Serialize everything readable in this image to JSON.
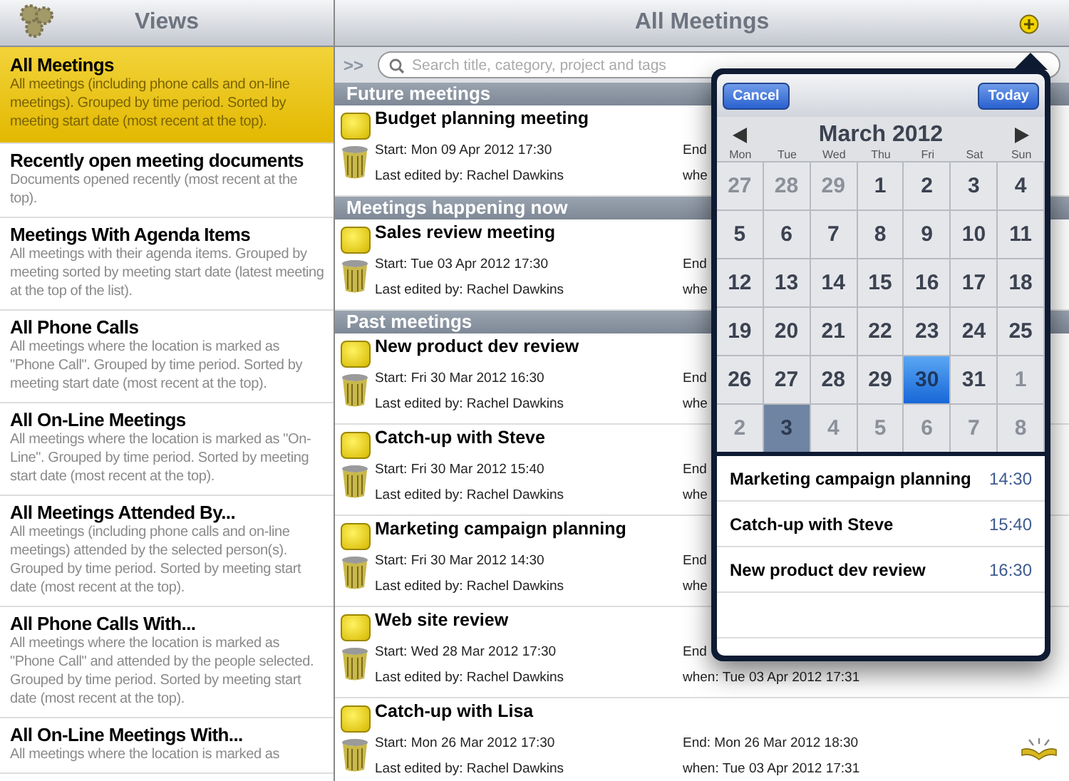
{
  "sidebar": {
    "title": "Views",
    "items": [
      {
        "title": "All Meetings",
        "description": "All meetings (including phone calls and on-line meetings). Grouped by time period. Sorted by meeting start date (most recent at the top).",
        "selected": true
      },
      {
        "title": "Recently open meeting documents",
        "description": "Documents opened recently (most recent at the top).",
        "selected": false
      },
      {
        "title": "Meetings With Agenda Items",
        "description": "All meetings with their agenda items. Grouped by meeting sorted by meeting start date (latest meeting at the top of the list).",
        "selected": false
      },
      {
        "title": "All Phone Calls",
        "description": "All meetings where the location is marked as \"Phone Call\". Grouped by time period. Sorted by meeting start date (most recent at the top).",
        "selected": false
      },
      {
        "title": "All On-Line Meetings",
        "description": "All meetings where the location is marked as \"On-Line\". Grouped by time period. Sorted by meeting start date (most recent at the top).",
        "selected": false
      },
      {
        "title": "All Meetings Attended By...",
        "description": "All meetings (including phone calls and on-line meetings) attended by the selected person(s). Grouped by time period. Sorted by meeting start date (most recent at the top).",
        "selected": false
      },
      {
        "title": "All Phone Calls With...",
        "description": "All meetings where the location is marked as \"Phone Call\" and attended by the people selected. Grouped by time period. Sorted by meeting start date (most recent at the top).",
        "selected": false
      },
      {
        "title": "All On-Line Meetings With...",
        "description": "All meetings where the location is marked as",
        "selected": false
      }
    ]
  },
  "main": {
    "title": "All Meetings",
    "expand": ">>",
    "search": {
      "placeholder": "Search title, category, project and tags"
    },
    "sections": [
      {
        "title": "Future meetings",
        "meetings": [
          {
            "title": "Budget planning meeting",
            "start": "Start: Mon 09 Apr 2012  17:30",
            "edited": "Last edited by: Rachel Dawkins",
            "end": "End",
            "when": "whe"
          }
        ]
      },
      {
        "title": "Meetings happening now",
        "meetings": [
          {
            "title": "Sales review meeting",
            "start": "Start: Tue 03 Apr 2012  17:30",
            "edited": "Last edited by: Rachel Dawkins",
            "end": "End",
            "when": "whe"
          }
        ]
      },
      {
        "title": "Past meetings",
        "meetings": [
          {
            "title": "New product dev review",
            "start": "Start: Fri 30 Mar 2012  16:30",
            "edited": "Last edited by: Rachel Dawkins",
            "end": "End",
            "when": "whe"
          },
          {
            "title": "Catch-up with Steve",
            "start": "Start: Fri 30 Mar 2012  15:40",
            "edited": "Last edited by: Rachel Dawkins",
            "end": "End",
            "when": "whe"
          },
          {
            "title": "Marketing campaign planning",
            "start": "Start: Fri 30 Mar 2012  14:30",
            "edited": "Last edited by: Rachel Dawkins",
            "end": "End",
            "when": "whe"
          },
          {
            "title": "Web site review",
            "start": "Start: Wed 28 Mar 2012  17:30",
            "edited": "Last edited by: Rachel Dawkins",
            "end": "End",
            "when": "when: Tue 03 Apr 2012  17:31"
          },
          {
            "title": "Catch-up with Lisa",
            "start": "Start: Mon 26 Mar 2012  17:30",
            "edited": "Last edited by: Rachel Dawkins",
            "end": "End: Mon 26 Mar 2012  18:30",
            "when": "when: Tue 03 Apr 2012  17:31"
          }
        ]
      }
    ]
  },
  "calendar": {
    "cancel": "Cancel",
    "today": "Today",
    "month": "March 2012",
    "weekdays": [
      "Mon",
      "Tue",
      "Wed",
      "Thu",
      "Fri",
      "Sat",
      "Sun"
    ],
    "days": [
      {
        "label": "27",
        "in_month": false,
        "selected": false,
        "today": false
      },
      {
        "label": "28",
        "in_month": false,
        "selected": false,
        "today": false
      },
      {
        "label": "29",
        "in_month": false,
        "selected": false,
        "today": false
      },
      {
        "label": "1",
        "in_month": true,
        "selected": false,
        "today": false
      },
      {
        "label": "2",
        "in_month": true,
        "selected": false,
        "today": false
      },
      {
        "label": "3",
        "in_month": true,
        "selected": false,
        "today": false
      },
      {
        "label": "4",
        "in_month": true,
        "selected": false,
        "today": false
      },
      {
        "label": "5",
        "in_month": true,
        "selected": false,
        "today": false
      },
      {
        "label": "6",
        "in_month": true,
        "selected": false,
        "today": false
      },
      {
        "label": "7",
        "in_month": true,
        "selected": false,
        "today": false
      },
      {
        "label": "8",
        "in_month": true,
        "selected": false,
        "today": false
      },
      {
        "label": "9",
        "in_month": true,
        "selected": false,
        "today": false
      },
      {
        "label": "10",
        "in_month": true,
        "selected": false,
        "today": false
      },
      {
        "label": "11",
        "in_month": true,
        "selected": false,
        "today": false
      },
      {
        "label": "12",
        "in_month": true,
        "selected": false,
        "today": false
      },
      {
        "label": "13",
        "in_month": true,
        "selected": false,
        "today": false
      },
      {
        "label": "14",
        "in_month": true,
        "selected": false,
        "today": false
      },
      {
        "label": "15",
        "in_month": true,
        "selected": false,
        "today": false
      },
      {
        "label": "16",
        "in_month": true,
        "selected": false,
        "today": false
      },
      {
        "label": "17",
        "in_month": true,
        "selected": false,
        "today": false
      },
      {
        "label": "18",
        "in_month": true,
        "selected": false,
        "today": false
      },
      {
        "label": "19",
        "in_month": true,
        "selected": false,
        "today": false
      },
      {
        "label": "20",
        "in_month": true,
        "selected": false,
        "today": false
      },
      {
        "label": "21",
        "in_month": true,
        "selected": false,
        "today": false
      },
      {
        "label": "22",
        "in_month": true,
        "selected": false,
        "today": false
      },
      {
        "label": "23",
        "in_month": true,
        "selected": false,
        "today": false
      },
      {
        "label": "24",
        "in_month": true,
        "selected": false,
        "today": false
      },
      {
        "label": "25",
        "in_month": true,
        "selected": false,
        "today": false
      },
      {
        "label": "26",
        "in_month": true,
        "selected": false,
        "today": false
      },
      {
        "label": "27",
        "in_month": true,
        "selected": false,
        "today": false
      },
      {
        "label": "28",
        "in_month": true,
        "selected": false,
        "today": false
      },
      {
        "label": "29",
        "in_month": true,
        "selected": false,
        "today": false
      },
      {
        "label": "30",
        "in_month": true,
        "selected": true,
        "today": false
      },
      {
        "label": "31",
        "in_month": true,
        "selected": false,
        "today": false
      },
      {
        "label": "1",
        "in_month": false,
        "selected": false,
        "today": false
      },
      {
        "label": "2",
        "in_month": false,
        "selected": false,
        "today": false
      },
      {
        "label": "3",
        "in_month": false,
        "selected": false,
        "today": true
      },
      {
        "label": "4",
        "in_month": false,
        "selected": false,
        "today": false
      },
      {
        "label": "5",
        "in_month": false,
        "selected": false,
        "today": false
      },
      {
        "label": "6",
        "in_month": false,
        "selected": false,
        "today": false
      },
      {
        "label": "7",
        "in_month": false,
        "selected": false,
        "today": false
      },
      {
        "label": "8",
        "in_month": false,
        "selected": false,
        "today": false
      }
    ],
    "events": [
      {
        "title": "Marketing campaign planning",
        "time": "14:30"
      },
      {
        "title": "Catch-up with Steve",
        "time": "15:40"
      },
      {
        "title": "New product dev review",
        "time": "16:30"
      }
    ]
  }
}
